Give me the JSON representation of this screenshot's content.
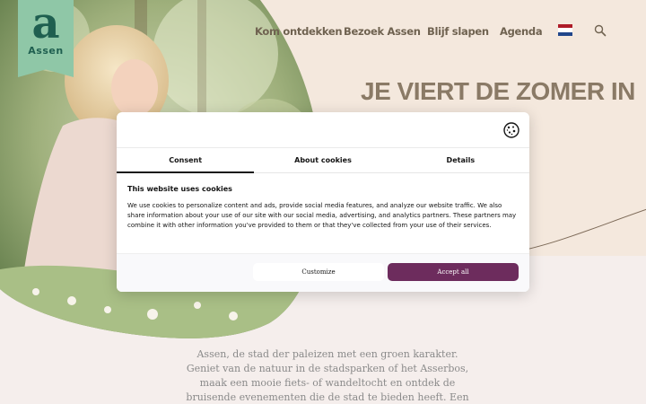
{
  "logo": {
    "glyph": "a",
    "word": "Assen"
  },
  "nav": {
    "items": [
      {
        "label": "Kom ontdekken"
      },
      {
        "label": "Bezoek Assen"
      },
      {
        "label": "Blijf slapen"
      },
      {
        "label": "Agenda"
      }
    ],
    "flag_colors": [
      "#ae1c28",
      "#ffffff",
      "#21468b"
    ]
  },
  "hero": {
    "title": "JE VIERT DE ZOMER IN"
  },
  "intro": {
    "text": "Assen, de stad der paleizen met een groen karakter. Geniet van de natuur in de stadsparken of het Asserbos, maak een mooie fiets- of wandeltocht en ontdek de bruisende evenementen die de stad te bieden heeft. Een stad met charme."
  },
  "cookie_dialog": {
    "tabs": [
      {
        "label": "Consent"
      },
      {
        "label": "About cookies"
      },
      {
        "label": "Details"
      }
    ],
    "active_tab": "Consent",
    "heading": "This website uses cookies",
    "body": "We use cookies to personalize content and ads, provide social media features, and analyze our website traffic. We also share information about your use of our site with our social media, advertising, and analytics partners. These partners may combine it with other information you've provided to them or that they've collected from your use of their services.",
    "customize_label": "Customize",
    "accept_label": "Accept all",
    "accent_color": "#6d2c5d"
  },
  "colors": {
    "page_background": "#f5eeec",
    "hero_background": "#f4e8dd",
    "nav_text": "#6f6250",
    "title_text": "#8a7a66",
    "logo_green": "#8fc7a7"
  }
}
